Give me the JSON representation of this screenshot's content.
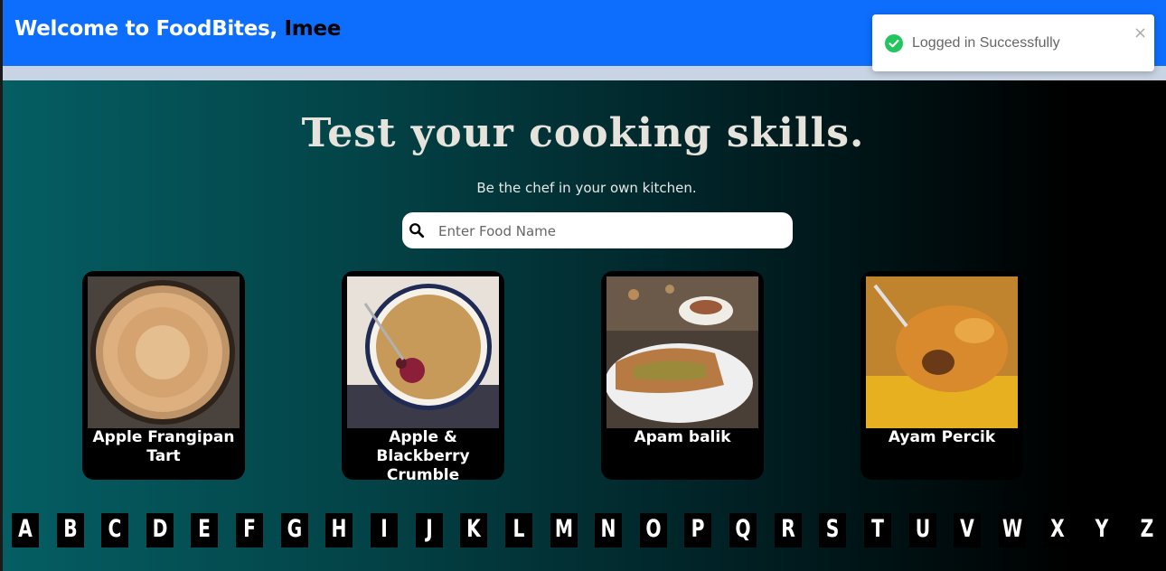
{
  "header": {
    "welcome": "Welcome to FoodBites,",
    "user": "Imee"
  },
  "toast": {
    "message": "Logged in Successfully",
    "close": "×"
  },
  "hero": {
    "title": "Test your cooking skills.",
    "subtitle": "Be the chef in your own kitchen."
  },
  "search": {
    "placeholder": "Enter Food Name"
  },
  "meals": [
    {
      "name": "Apple Frangipan Tart"
    },
    {
      "name": "Apple & Blackberry Crumble"
    },
    {
      "name": "Apam balik"
    },
    {
      "name": "Ayam Percik"
    }
  ],
  "letters": [
    "A",
    "B",
    "C",
    "D",
    "E",
    "F",
    "G",
    "H",
    "I",
    "J",
    "K",
    "L",
    "M",
    "N",
    "O",
    "P",
    "Q",
    "R",
    "S",
    "T",
    "U",
    "V",
    "W",
    "X",
    "Y",
    "Z"
  ],
  "colors": {
    "navbar": "#0d6efd",
    "success": "#22c55e",
    "card": "#000000"
  }
}
